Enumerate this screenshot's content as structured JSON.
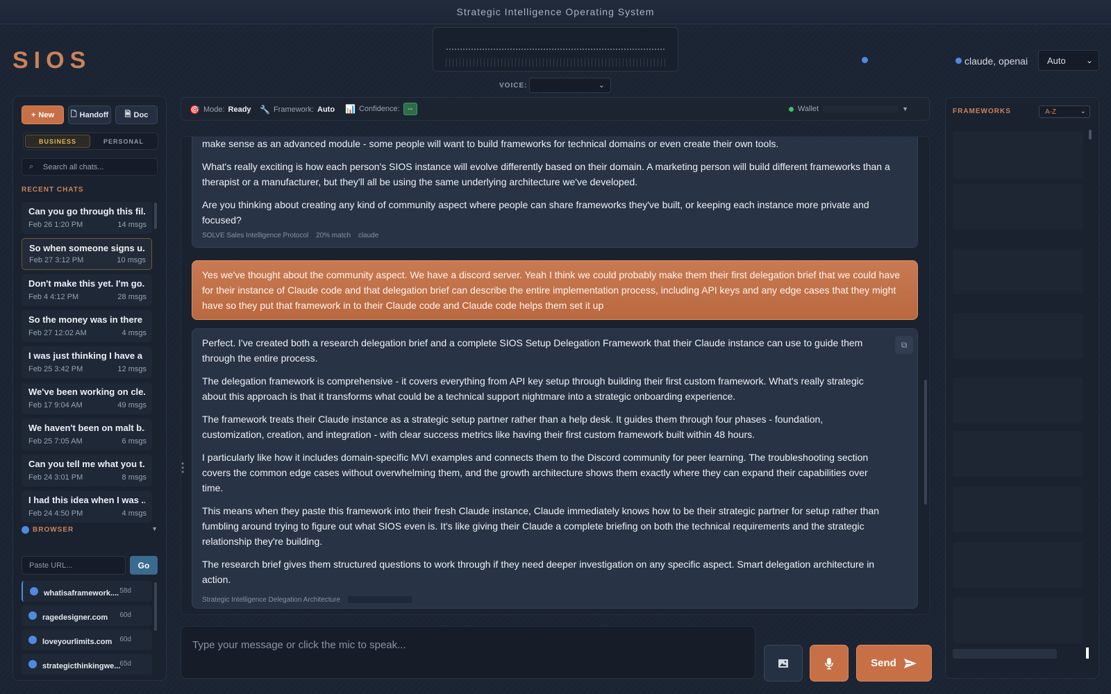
{
  "window": {
    "title": "Strategic Intelligence Operating System"
  },
  "header": {
    "logo": "SIOS",
    "voice_label": "VOICE:",
    "providers": "claude, openai",
    "model_select": "Auto"
  },
  "sidebar": {
    "buttons": {
      "new": "New",
      "handoff": "Handoff",
      "doc": "Doc"
    },
    "segments": [
      "BUSINESS",
      "PERSONAL"
    ],
    "active_segment": "BUSINESS",
    "search_placeholder": "Search all chats...",
    "recent_title": "RECENT CHATS",
    "chats": [
      {
        "title": "Can you go through this fil...",
        "date": "Feb 26 1:20 PM",
        "msgs": "14 msgs"
      },
      {
        "title": "So when someone signs u...",
        "date": "Feb 27 3:12 PM",
        "msgs": "10 msgs"
      },
      {
        "title": "Don't make this yet. I'm go...",
        "date": "Feb 4 4:12 PM",
        "msgs": "28 msgs"
      },
      {
        "title": "So the money was in there ...",
        "date": "Feb 27 12:02 AM",
        "msgs": "4 msgs"
      },
      {
        "title": "I was just thinking I have a ...",
        "date": "Feb 25 3:42 PM",
        "msgs": "12 msgs"
      },
      {
        "title": "We've been working on cle...",
        "date": "Feb 17 9:04 AM",
        "msgs": "49 msgs"
      },
      {
        "title": "We haven't been on malt b...",
        "date": "Feb 25 7:05 AM",
        "msgs": "6 msgs"
      },
      {
        "title": "Can you tell me what you t...",
        "date": "Feb 24 3:01 PM",
        "msgs": "8 msgs"
      },
      {
        "title": "I had this idea when I was ...",
        "date": "Feb 24 4:50 PM",
        "msgs": "4 msgs"
      }
    ],
    "active_chat_index": 1,
    "browser": {
      "title": "BROWSER",
      "url_placeholder": "Paste URL...",
      "go_label": "Go",
      "items": [
        {
          "url": "whatisaframework....",
          "age": "58d"
        },
        {
          "url": "ragedesigner.com",
          "age": "60d"
        },
        {
          "url": "loveyourlimits.com",
          "age": "60d"
        },
        {
          "url": "strategicthinkingwe...",
          "age": "65d"
        }
      ]
    }
  },
  "toolbar": {
    "mode_label": "Mode:",
    "mode_value": "Ready",
    "framework_label": "Framework:",
    "framework_value": "Auto",
    "confidence_label": "Confidence:",
    "confidence_value": "--",
    "wallet_label": "Wallet"
  },
  "messages": [
    {
      "role": "assistant",
      "paragraphs": [
        "make sense as an advanced module - some people will want to build frameworks for technical domains or even create their own tools.",
        "What's really exciting is how each person's SIOS instance will evolve differently based on their domain. A marketing person will build different frameworks than a therapist or a manufacturer, but they'll all be using the same underlying architecture we've developed.",
        "Are you thinking about creating any kind of community aspect where people can share frameworks they've built, or keeping each instance more private and focused?"
      ],
      "meta": [
        "SOLVE Sales Intelligence Protocol",
        "20% match",
        "claude"
      ]
    },
    {
      "role": "user",
      "paragraphs": [
        "Yes we've thought about the community aspect. We have a discord server. Yeah I think we could probably make them their first delegation brief that we could have for their instance of Claude code and that delegation brief can describe the entire implementation process, including API keys and any edge cases that they might have so they put that framework in to their Claude code and Claude code helps them set it up"
      ]
    },
    {
      "role": "assistant",
      "paragraphs": [
        "Perfect. I've created both a research delegation brief and a complete SIOS Setup Delegation Framework that their Claude instance can use to guide them through the entire process.",
        "The delegation framework is comprehensive - it covers everything from API key setup through building their first custom framework. What's really strategic about this approach is that it transforms what could be a technical support nightmare into a strategic onboarding experience.",
        "The framework treats their Claude instance as a strategic setup partner rather than a help desk. It guides them through four phases - foundation, customization, creation, and integration - with clear success metrics like having their first custom framework built within 48 hours.",
        "I particularly like how it includes domain-specific MVI examples and connects them to the Discord community for peer learning. The troubleshooting section covers the common edge cases without overwhelming them, and the growth architecture shows them exactly where they can expand their capabilities over time.",
        "This means when they paste this framework into their fresh Claude instance, Claude immediately knows how to be their strategic partner for setup rather than fumbling around trying to figure out what SIOS even is. It's like giving their Claude a complete briefing on both the technical requirements and the strategic relationship they're building.",
        "The research brief gives them structured questions to work through if they need deeper investigation on any specific aspect. Smart delegation architecture in action."
      ],
      "meta": [
        "Strategic Intelligence Delegation Architecture"
      ]
    }
  ],
  "composer": {
    "placeholder": "Type your message or click the mic to speak...",
    "send_label": "Send"
  },
  "right_panel": {
    "title": "FRAMEWORKS",
    "sort": "A-Z"
  },
  "colors": {
    "accent": "#c76f45",
    "highlight": "#e0b55b",
    "link": "#4f8ae0",
    "bg": "#1b2433"
  },
  "icons": {
    "new": "plus-icon",
    "handoff": "document-icon",
    "doc": "file-icon",
    "search": "search-icon",
    "mode": "target-icon",
    "framework": "wrench-icon",
    "confidence": "chart-icon",
    "copy": "copy-icon",
    "image": "image-icon",
    "mic": "microphone-icon",
    "send": "send-icon"
  }
}
